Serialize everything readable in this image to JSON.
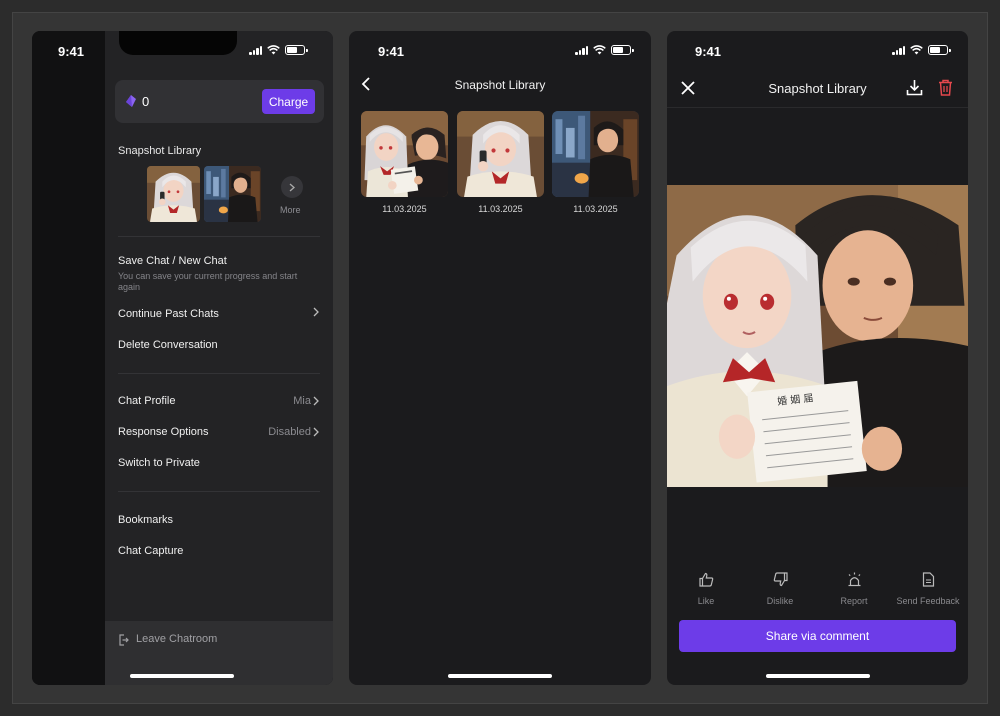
{
  "status_bar": {
    "time": "9:41"
  },
  "menu_panel": {
    "coin_balance": "0",
    "charge_label": "Charge",
    "snapshot_label": "Snapshot Library",
    "more_label": "More",
    "save_chat": {
      "title": "Save Chat / New Chat",
      "subtitle": "You can save your current progress and start again"
    },
    "continue_past": "Continue Past Chats",
    "delete_conversation": "Delete Conversation",
    "chat_profile": {
      "label": "Chat Profile",
      "value": "Mia"
    },
    "response_options": {
      "label": "Response Options",
      "value": "Disabled"
    },
    "switch_private": "Switch to Private",
    "bookmarks": "Bookmarks",
    "chat_capture": "Chat Capture",
    "leave_chatroom": "Leave Chatroom"
  },
  "library_screen": {
    "title": "Snapshot Library",
    "items": [
      {
        "date": "11.03.2025"
      },
      {
        "date": "11.03.2025"
      },
      {
        "date": "11.03.2025"
      }
    ]
  },
  "detail_screen": {
    "title": "Snapshot Library",
    "actions": [
      {
        "label": "Like",
        "icon": "thumbs-up-icon"
      },
      {
        "label": "Dislike",
        "icon": "thumbs-down-icon"
      },
      {
        "label": "Report",
        "icon": "siren-icon"
      },
      {
        "label": "Send Feedback",
        "icon": "document-icon"
      }
    ],
    "share_button": "Share via comment",
    "document_text": "婚 姻 届"
  },
  "colors": {
    "accent": "#6d3ce8",
    "trash": "#e5484d",
    "background": "#1b1b1d"
  }
}
